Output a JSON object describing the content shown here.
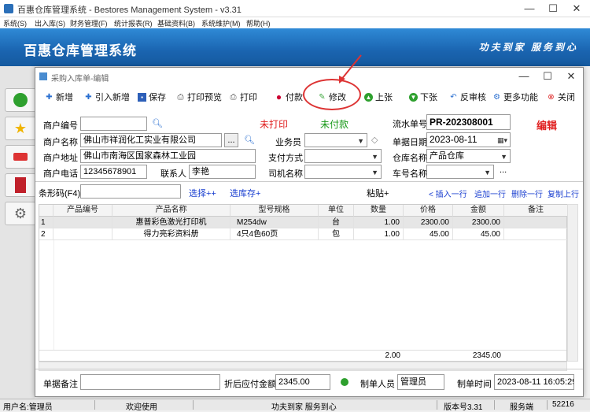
{
  "window": {
    "title": "百惠仓库管理系统 - Bestores Management System - v3.31",
    "min": "—",
    "max": "☐",
    "close": "✕"
  },
  "menu": [
    "系统(S)",
    "出入库(S)",
    "财务管理(F)",
    "统计报表(R)",
    "基础资料(B)",
    "系统维护(M)",
    "帮助(H)"
  ],
  "banner": {
    "title": "百惠仓库管理系统",
    "slogan": "功夫到家 服务到心"
  },
  "dialog": {
    "title": "采购入库单-编辑",
    "toolbar": [
      "新增",
      "引入新增",
      "保存",
      "打印预览",
      "打印",
      "付款",
      "修改",
      "上张",
      "下张",
      "反审核",
      "更多功能",
      "关闭"
    ],
    "form": {
      "merchant_code_label": "商户编号",
      "merchant_code": "",
      "print_status": "未打印",
      "pay_status": "未付款",
      "serial_label": "流水单号",
      "serial": "PR-202308001",
      "mode": "编辑",
      "merchant_name_label": "商户名称",
      "merchant_name": "佛山市祥润化工实业有限公司",
      "ellipsis": "...",
      "salesman_label": "业务员",
      "salesman": "",
      "date_label": "单据日期",
      "date": "2023-08-11",
      "address_label": "商户地址",
      "address": "佛山市南海区国家森林工业园",
      "pay_method_label": "支付方式",
      "pay_method": "",
      "warehouse_label": "仓库名称",
      "warehouse": "产品仓库",
      "phone_label": "商户电话",
      "phone": "12345678901",
      "contact_label": "联系人",
      "contact": "李艳",
      "driver_label": "司机名称",
      "driver": "",
      "plate_label": "车号名称",
      "plate": "",
      "plate_more": "..."
    },
    "barcode": {
      "label": "条形码(F4)",
      "value": "",
      "select": "选择++",
      "select_stock": "选库存+",
      "paste": "粘贴+",
      "insert_row": "< 插入一行",
      "append_row": "追加一行",
      "delete_row": "删除一行",
      "copy_row": "复制上行"
    },
    "grid": {
      "headers": [
        "",
        "产品编号",
        "产品名称",
        "型号规格",
        "单位",
        "数量",
        "价格",
        "金额",
        "备注"
      ],
      "rows": [
        [
          "1",
          "",
          "惠普彩色激光打印机",
          "M254dw",
          "台",
          "1.00",
          "2300.00",
          "2300.00",
          ""
        ],
        [
          "2",
          "",
          "得力亮彩资料册",
          "4只4色60页",
          "包",
          "1.00",
          "45.00",
          "45.00",
          ""
        ]
      ],
      "total_qty": "2.00",
      "total_amount": "2345.00"
    },
    "footer": {
      "remark_label": "单据备注",
      "remark": "",
      "discount_label": "折后应付金额",
      "discount": "2345.00",
      "maker_label": "制单人员",
      "maker": "管理员",
      "time_label": "制单时间",
      "time": "2023-08-11 16:05:29"
    }
  },
  "status": {
    "user": "用户名:管理员",
    "welcome": "欢迎使用",
    "slogan": "功夫到家 服务到心",
    "version": "版本号3.31",
    "service": "服务端",
    "port": "52216"
  }
}
